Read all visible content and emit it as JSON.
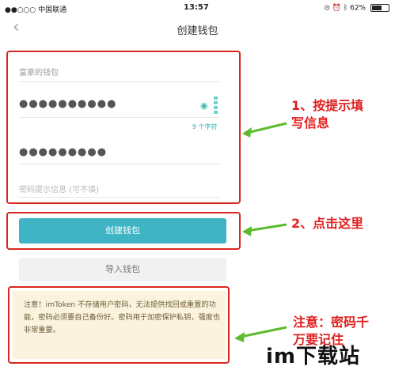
{
  "status_bar": {
    "carrier": "●●○○○ 中国联通",
    "time": "13:57",
    "battery": "62%"
  },
  "nav": {
    "title": "创建钱包"
  },
  "form": {
    "wallet_name": "富豪的钱包",
    "password": "●●●●●●●●●●",
    "char_count": "9 个字符",
    "confirm_password": "●●●●●●●●●",
    "hint_placeholder": "密码提示信息 (可不填)"
  },
  "buttons": {
    "create": "创建钱包",
    "import": "导入钱包"
  },
  "notice": {
    "text": "注意！imToken 不存储用户密码，无法提供找回或重置的功能，密码必须要自己备份好。密码用于加密保护私钥，强度也非常重要。"
  },
  "annotations": {
    "step1_line1": "1、按提示填",
    "step1_line2": "写信息",
    "step2": "2、点击这里",
    "note_line1": "注意：密码千",
    "note_line2": "万要记住"
  },
  "watermark": "im下载站",
  "colors": {
    "accent": "#3fb4c4",
    "annotation_red": "#e02020",
    "arrow_green": "#5dbb2e",
    "notice_bg": "#fbf3dd"
  }
}
